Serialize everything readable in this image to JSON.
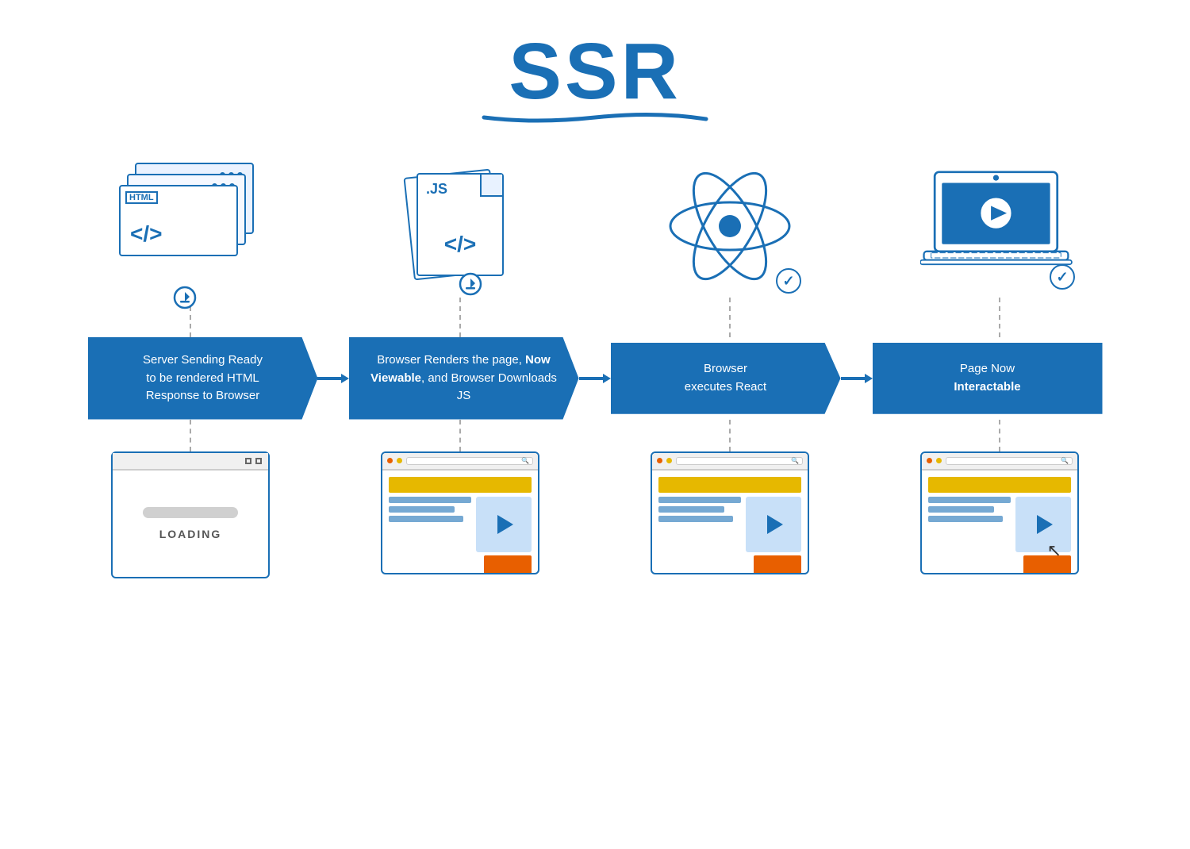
{
  "title": {
    "text": "SSR"
  },
  "columns": [
    {
      "id": "html",
      "icon": "html-stack-icon",
      "label": "Server Sending Ready to be rendered HTML Response to Browser",
      "label_parts": [
        "Server Sending Ready",
        "to be rendered HTML",
        "Response to Browser"
      ],
      "bold_parts": [],
      "bottom_label": "LOADING"
    },
    {
      "id": "js",
      "icon": "js-file-icon",
      "label": "Browser Renders the page, Now Viewable, and Browser Downloads JS",
      "label_parts": [
        "Browser Renders the page, ",
        "Now Viewable",
        ", and Browser Downloads JS"
      ],
      "bold_parts": [
        "Now Viewable"
      ]
    },
    {
      "id": "react",
      "icon": "react-atom-icon",
      "label": "Browser executes React",
      "label_parts": [
        "Browser",
        "executes React"
      ],
      "bold_parts": []
    },
    {
      "id": "laptop",
      "icon": "laptop-icon",
      "label": "Page Now Interactable",
      "label_parts": [
        "Page Now",
        "Interactable"
      ],
      "bold_parts": [
        "Interactable"
      ]
    }
  ],
  "checkmarks": [
    "✓",
    "✓"
  ],
  "loading_text": "LOADING",
  "colors": {
    "blue": "#1a6fb5",
    "yellow": "#e6b800",
    "orange": "#e85f00",
    "light_blue": "#c8e0f8"
  }
}
